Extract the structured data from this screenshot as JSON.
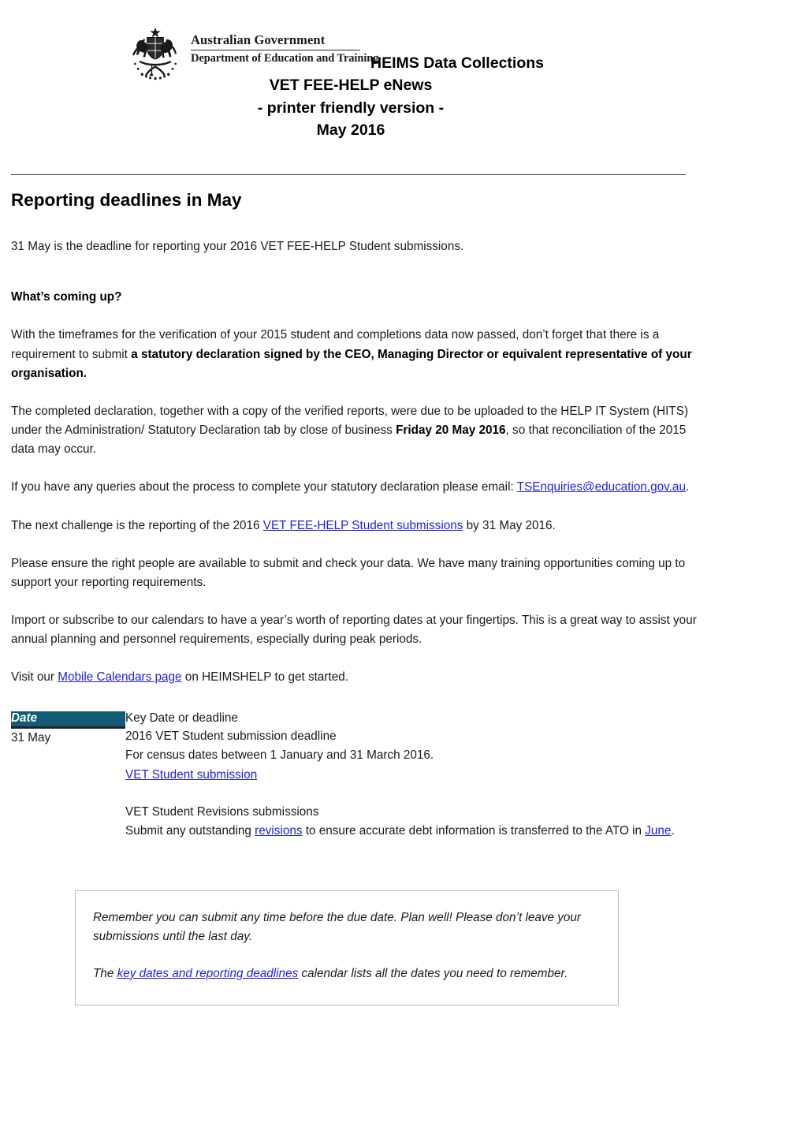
{
  "masthead": {
    "crest_icon": "australian-coat-of-arms",
    "gov_line1": "Australian Government",
    "gov_line2": "Department of Education and Training",
    "title_line1": "HEIMS Data Collections",
    "title_line2": "VET FEE-HELP eNews",
    "title_line3": "- printer friendly version -",
    "title_line4": "May 2016"
  },
  "content": {
    "section_heading": "Reporting deadlines in May",
    "deadline_intro": "31 May is the deadline for reporting your 2016 VET FEE-HELP Student submissions.",
    "coming_up_heading": "What’s coming up?",
    "para_statdec_a": "With the timeframes for the verification of your 2015 student and completions data now passed, don’t forget that there is a requirement to submit ",
    "para_statdec_bold": "a statutory declaration signed by the CEO, Managing Director or equivalent representative of your organisation.",
    "para_declaration_a": "The completed declaration, together with a copy of the verified reports, were due to be uploaded to the HELP IT System (HITS) under the Administration/ Statutory Declaration tab by close of business ",
    "para_declaration_bold": "Friday 20 May 2016",
    "para_declaration_b": ", so that reconciliation of the 2015 data may occur.",
    "para_queries_a": "If you have any queries about the process to complete your statutory declaration please email: ",
    "email_link": "TSEnquiries@education.gov.au",
    "para_queries_b": ".",
    "para_next_a": "The next challenge is the reporting of the 2016 ",
    "next_link": "VET FEE-HELP Student submissions",
    "para_next_b": " by 31 May 2016.",
    "para_people": "Please ensure the right people are available to submit and check your data. We have many training opportunities coming up to support your reporting requirements.",
    "para_calendars": "Import or subscribe to our calendars to have a year’s worth of reporting dates at your fingertips. This is a great way to assist your annual planning and personnel requirements, especially during peak periods.",
    "para_visit_a": "Visit our ",
    "visit_link": "Mobile Calendars page",
    "para_visit_b": " on HEIMSHELP to get started."
  },
  "table": {
    "header_date": "Date",
    "header_desc": "Key Date or deadline",
    "header_bg": "#125C75",
    "rows": [
      {
        "date": "31 May",
        "line1": "2016 VET Student submission deadline",
        "line2": "For census dates between 1 January and 31 March 2016.",
        "link1": "VET Student submission",
        "line3": "VET Student Revisions submissions",
        "line4_a": "Submit any outstanding ",
        "link2": "revisions",
        "line4_b": " to ensure accurate debt information is transferred to the ATO in ",
        "link3": "June",
        "line4_c": "."
      }
    ]
  },
  "callout": {
    "para1": "Remember you can submit any time before the due date. Plan well! Please don’t leave your submissions until the last day.",
    "para2_a": "The ",
    "link": "key dates and reporting deadlines",
    "para2_b": " calendar lists all the dates you need to remember.",
    "border_color": "#b8b8b8"
  },
  "colors": {
    "link": "#1f1fd6",
    "table_header": "#125C75",
    "rule": "#3a3a3a"
  }
}
